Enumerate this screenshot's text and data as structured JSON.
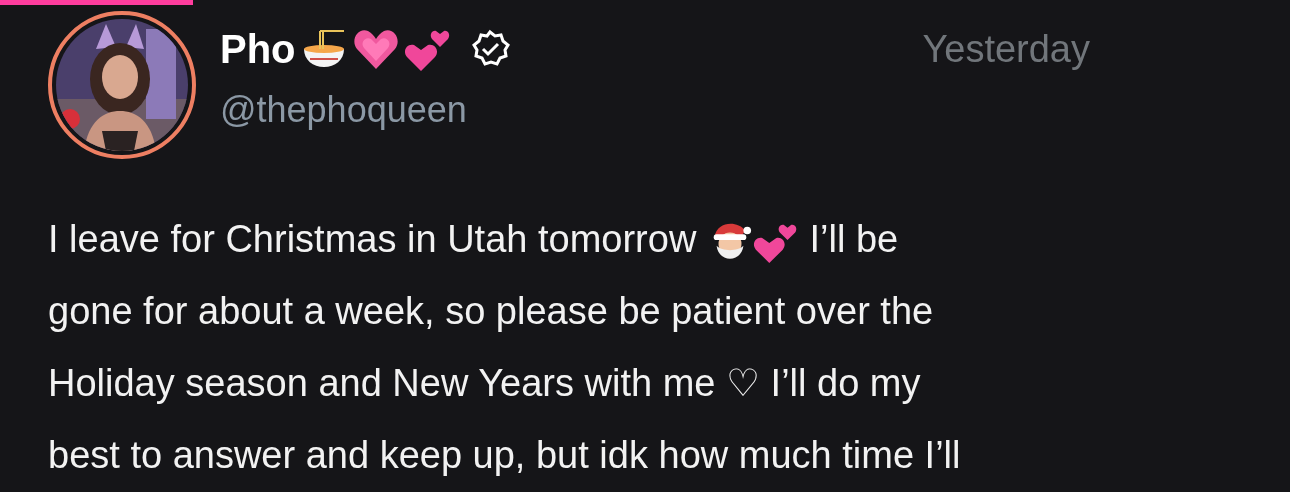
{
  "tab_indicator": {
    "selected": true
  },
  "author": {
    "name": "Pho",
    "name_icons": [
      {
        "kind": "bowl"
      },
      {
        "kind": "heart"
      },
      {
        "kind": "hearts"
      }
    ],
    "verified": true,
    "handle": "@thephoqueen",
    "time": "Yesterday"
  },
  "body": {
    "lines": [
      [
        {
          "kind": "text",
          "text": "I leave for Christmas in Utah tomorrow "
        },
        {
          "kind": "santa"
        },
        {
          "kind": "hearts"
        },
        {
          "kind": "text",
          "text": " I’ll be"
        }
      ],
      [
        {
          "kind": "text",
          "text": "gone for about a week, so please be patient over the"
        }
      ],
      [
        {
          "kind": "text",
          "text": "Holiday season and New Years with me ♡ I’ll do my"
        }
      ],
      [
        {
          "kind": "text",
          "text": "best to answer and keep up, but idk how much time I’ll"
        }
      ]
    ]
  }
}
